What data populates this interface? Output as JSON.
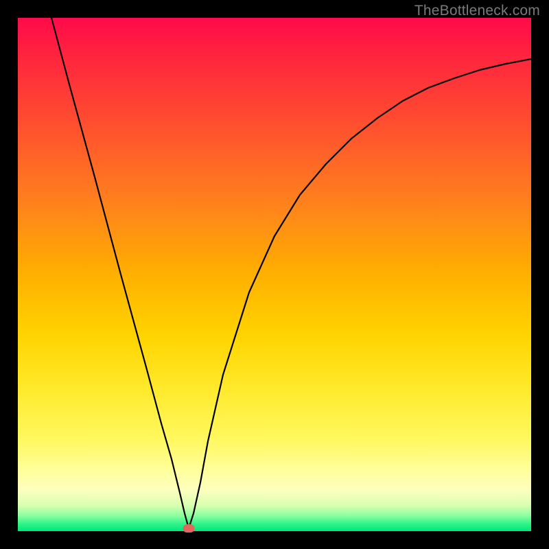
{
  "watermark": "TheBottleneck.com",
  "marker": {
    "x_frac": 0.333,
    "y_frac": 0.995
  },
  "chart_data": {
    "type": "line",
    "title": "",
    "xlabel": "",
    "ylabel": "",
    "xlim": [
      0,
      1
    ],
    "ylim": [
      0,
      1
    ],
    "series": [
      {
        "name": "bottleneck-curve",
        "x": [
          0.065,
          0.1,
          0.15,
          0.2,
          0.25,
          0.28,
          0.3,
          0.315,
          0.325,
          0.333,
          0.342,
          0.355,
          0.37,
          0.4,
          0.45,
          0.5,
          0.55,
          0.6,
          0.65,
          0.7,
          0.75,
          0.8,
          0.85,
          0.9,
          0.95,
          1.0
        ],
        "y": [
          1.0,
          0.87,
          0.69,
          0.5,
          0.32,
          0.21,
          0.14,
          0.075,
          0.035,
          0.005,
          0.035,
          0.095,
          0.175,
          0.305,
          0.465,
          0.575,
          0.655,
          0.715,
          0.765,
          0.805,
          0.838,
          0.863,
          0.882,
          0.898,
          0.91,
          0.92
        ]
      }
    ],
    "annotations": [
      {
        "name": "optimal-point",
        "x": 0.333,
        "y": 0.005
      }
    ],
    "background_gradient": {
      "top": "#ff0a4a",
      "mid": "#ffd400",
      "bottom": "#00e67a"
    }
  }
}
